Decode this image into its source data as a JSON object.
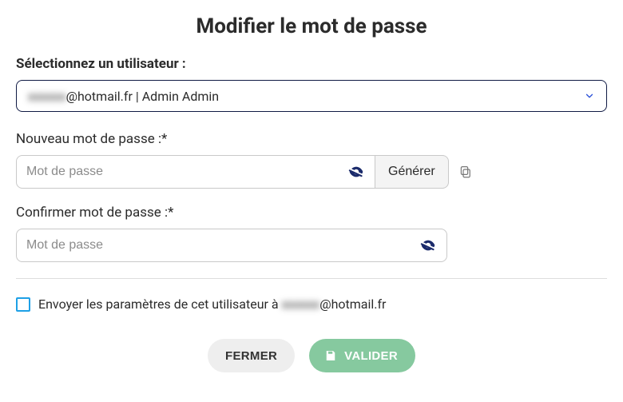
{
  "title": "Modifier le mot de passe",
  "user": {
    "label": "Sélectionnez un utilisateur :",
    "selected_prefix_hidden": "xxxxxx",
    "selected_suffix": "@hotmail.fr | Admin Admin"
  },
  "newpass": {
    "label": "Nouveau mot de passe :*",
    "placeholder": "Mot de passe",
    "value": ""
  },
  "confirm": {
    "label": "Confirmer mot de passe :*",
    "placeholder": "Mot de passe",
    "value": ""
  },
  "generate_label": "Générer",
  "send_params": {
    "prefix": "Envoyer les paramètres de cet utilisateur à ",
    "hidden": "xxxxxx",
    "suffix": "@hotmail.fr",
    "checked": false
  },
  "actions": {
    "close": "FERMER",
    "submit": "VALIDER"
  }
}
